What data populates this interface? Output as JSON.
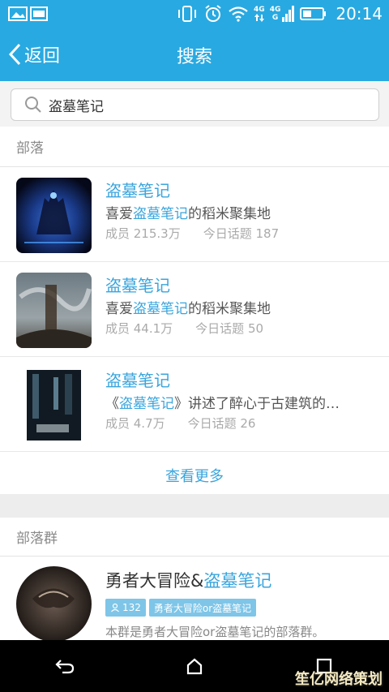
{
  "status_bar": {
    "net_top": "4G",
    "net_mid": "4G",
    "net_bot": "G",
    "time": "20:14"
  },
  "header": {
    "back_label": "返回",
    "title": "搜索"
  },
  "search": {
    "value": "盗墓笔记"
  },
  "tribes": {
    "header": "部落",
    "items": [
      {
        "name": "盗墓笔记",
        "desc_prefix": "喜爱",
        "desc_highlight": "盗墓笔记",
        "desc_suffix": "的稻米聚集地",
        "members": "成员 215.3万",
        "topics": "今日话题 187"
      },
      {
        "name": "盗墓笔记",
        "desc_prefix": "喜爱",
        "desc_highlight": "盗墓笔记",
        "desc_suffix": "的稻米聚集地",
        "members": "成员 44.1万",
        "topics": "今日话题 50"
      },
      {
        "name": "盗墓笔记",
        "desc_prefix": "《",
        "desc_highlight": "盗墓笔记",
        "desc_suffix": "》讲述了醉心于古建筑的…",
        "members": "成员 4.7万",
        "topics": "今日话题 26"
      }
    ],
    "more_label": "查看更多"
  },
  "groups": {
    "header": "部落群",
    "items": [
      {
        "name_prefix": "勇者大冒险&",
        "name_highlight": "盗墓笔记",
        "member_count": "132",
        "tag": "勇者大冒险or盗墓笔记",
        "desc": "本群是勇者大冒险or盗墓笔记的部落群。"
      }
    ]
  },
  "watermark": "笙亿网络策划",
  "colors": {
    "brand": "#29a9e1",
    "link": "#3aa5dd"
  }
}
